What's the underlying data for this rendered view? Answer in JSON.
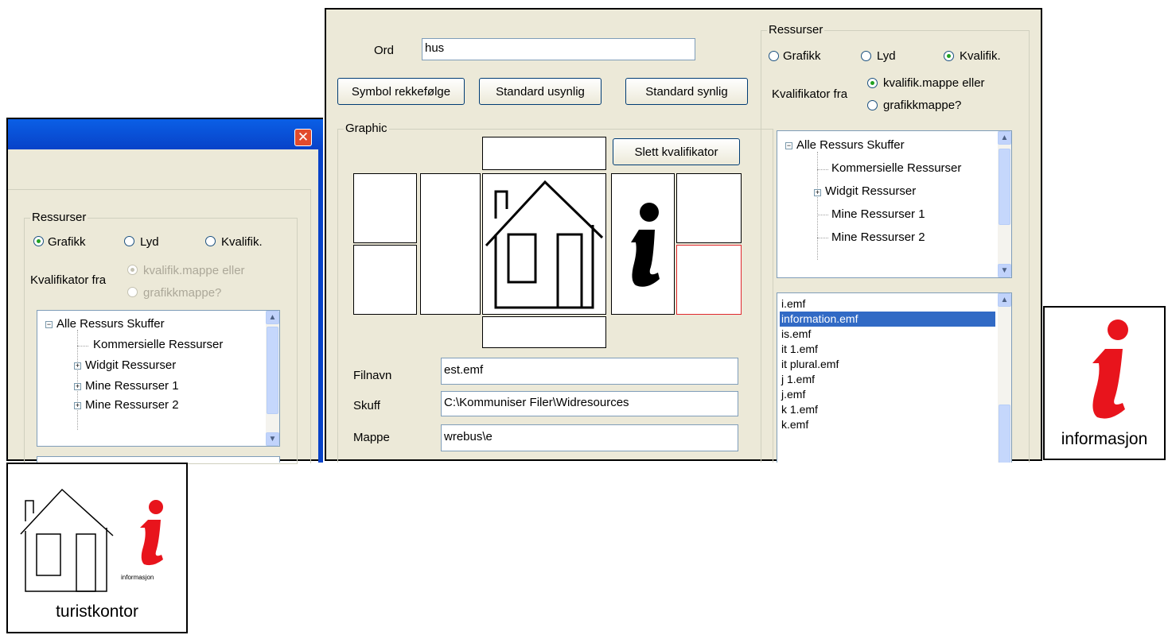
{
  "left_window": {
    "group_title": "Ressurser",
    "radios": [
      "Grafikk",
      "Lyd",
      "Kvalifik."
    ],
    "qualifier_label": "Kvalifikator fra",
    "qualifier_options": [
      "kvalifik.mappe eller",
      "grafikkmappe?"
    ],
    "tree": [
      "Alle Ressurs Skuffer",
      "Kommersielle Ressurser",
      "Widgit Ressurser",
      "Mine Ressurser 1",
      "Mine Ressurser 2"
    ]
  },
  "main_window": {
    "word_label": "Ord",
    "word_value": "hus",
    "buttons": {
      "symbol_order": "Symbol rekkefølge",
      "std_invisible": "Standard usynlig",
      "std_visible": "Standard synlig",
      "delete_qualifier": "Slett kvalifikator"
    },
    "graphic_title": "Graphic",
    "fields": {
      "filename_label": "Filnavn",
      "filename_value": "est.emf",
      "drawer_label": "Skuff",
      "drawer_value": "C:\\Kommuniser Filer\\Widresources",
      "folder_label": "Mappe",
      "folder_value": "wrebus\\e"
    },
    "resources": {
      "group_title": "Ressurser",
      "radios": [
        "Grafikk",
        "Lyd",
        "Kvalifik."
      ],
      "qualifier_label": "Kvalifikator fra",
      "qualifier_options": [
        "kvalifik.mappe eller",
        "grafikkmappe?"
      ],
      "tree": [
        "Alle Ressurs Skuffer",
        "Kommersielle Ressurser",
        "Widgit Ressurser",
        "Mine Ressurser 1",
        "Mine Ressurser 2"
      ],
      "files": [
        "i.emf",
        "information.emf",
        "is.emf",
        "it 1.emf",
        "it plural.emf",
        "j 1.emf",
        "j.emf",
        "k 1.emf",
        "k.emf"
      ],
      "selected_file": "information.emf"
    }
  },
  "symbol_info": {
    "caption": "informasjon",
    "icon": "information-i-red"
  },
  "symbol_tourist": {
    "caption": "turistkontor",
    "sub_caption": "informasjon",
    "icon": "house-with-info"
  },
  "colors": {
    "accent_red": "#e8141c",
    "selection": "#316ac5",
    "panel": "#ece9d8"
  }
}
